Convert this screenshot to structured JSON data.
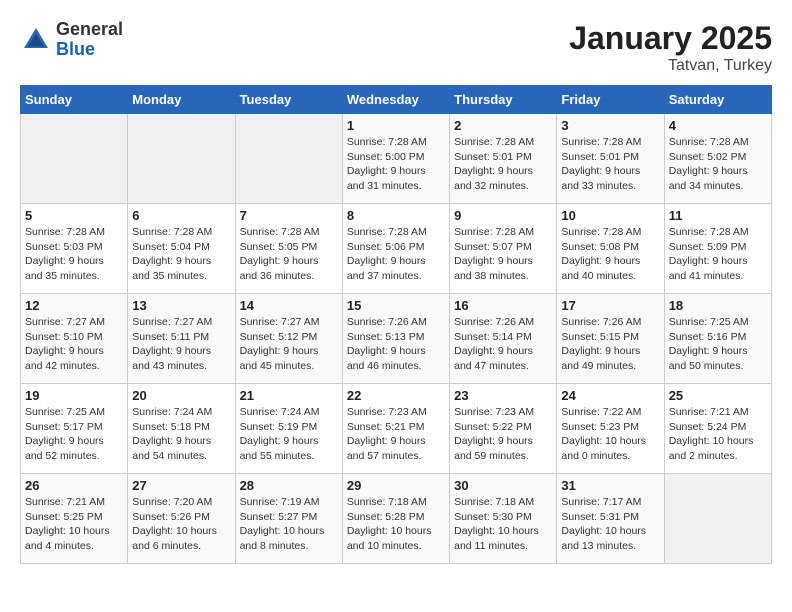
{
  "header": {
    "logo_general": "General",
    "logo_blue": "Blue",
    "month_year": "January 2025",
    "location": "Tatvan, Turkey"
  },
  "weekdays": [
    "Sunday",
    "Monday",
    "Tuesday",
    "Wednesday",
    "Thursday",
    "Friday",
    "Saturday"
  ],
  "weeks": [
    [
      {
        "day": "",
        "info": ""
      },
      {
        "day": "",
        "info": ""
      },
      {
        "day": "",
        "info": ""
      },
      {
        "day": "1",
        "info": "Sunrise: 7:28 AM\nSunset: 5:00 PM\nDaylight: 9 hours and 31 minutes."
      },
      {
        "day": "2",
        "info": "Sunrise: 7:28 AM\nSunset: 5:01 PM\nDaylight: 9 hours and 32 minutes."
      },
      {
        "day": "3",
        "info": "Sunrise: 7:28 AM\nSunset: 5:01 PM\nDaylight: 9 hours and 33 minutes."
      },
      {
        "day": "4",
        "info": "Sunrise: 7:28 AM\nSunset: 5:02 PM\nDaylight: 9 hours and 34 minutes."
      }
    ],
    [
      {
        "day": "5",
        "info": "Sunrise: 7:28 AM\nSunset: 5:03 PM\nDaylight: 9 hours and 35 minutes."
      },
      {
        "day": "6",
        "info": "Sunrise: 7:28 AM\nSunset: 5:04 PM\nDaylight: 9 hours and 35 minutes."
      },
      {
        "day": "7",
        "info": "Sunrise: 7:28 AM\nSunset: 5:05 PM\nDaylight: 9 hours and 36 minutes."
      },
      {
        "day": "8",
        "info": "Sunrise: 7:28 AM\nSunset: 5:06 PM\nDaylight: 9 hours and 37 minutes."
      },
      {
        "day": "9",
        "info": "Sunrise: 7:28 AM\nSunset: 5:07 PM\nDaylight: 9 hours and 38 minutes."
      },
      {
        "day": "10",
        "info": "Sunrise: 7:28 AM\nSunset: 5:08 PM\nDaylight: 9 hours and 40 minutes."
      },
      {
        "day": "11",
        "info": "Sunrise: 7:28 AM\nSunset: 5:09 PM\nDaylight: 9 hours and 41 minutes."
      }
    ],
    [
      {
        "day": "12",
        "info": "Sunrise: 7:27 AM\nSunset: 5:10 PM\nDaylight: 9 hours and 42 minutes."
      },
      {
        "day": "13",
        "info": "Sunrise: 7:27 AM\nSunset: 5:11 PM\nDaylight: 9 hours and 43 minutes."
      },
      {
        "day": "14",
        "info": "Sunrise: 7:27 AM\nSunset: 5:12 PM\nDaylight: 9 hours and 45 minutes."
      },
      {
        "day": "15",
        "info": "Sunrise: 7:26 AM\nSunset: 5:13 PM\nDaylight: 9 hours and 46 minutes."
      },
      {
        "day": "16",
        "info": "Sunrise: 7:26 AM\nSunset: 5:14 PM\nDaylight: 9 hours and 47 minutes."
      },
      {
        "day": "17",
        "info": "Sunrise: 7:26 AM\nSunset: 5:15 PM\nDaylight: 9 hours and 49 minutes."
      },
      {
        "day": "18",
        "info": "Sunrise: 7:25 AM\nSunset: 5:16 PM\nDaylight: 9 hours and 50 minutes."
      }
    ],
    [
      {
        "day": "19",
        "info": "Sunrise: 7:25 AM\nSunset: 5:17 PM\nDaylight: 9 hours and 52 minutes."
      },
      {
        "day": "20",
        "info": "Sunrise: 7:24 AM\nSunset: 5:18 PM\nDaylight: 9 hours and 54 minutes."
      },
      {
        "day": "21",
        "info": "Sunrise: 7:24 AM\nSunset: 5:19 PM\nDaylight: 9 hours and 55 minutes."
      },
      {
        "day": "22",
        "info": "Sunrise: 7:23 AM\nSunset: 5:21 PM\nDaylight: 9 hours and 57 minutes."
      },
      {
        "day": "23",
        "info": "Sunrise: 7:23 AM\nSunset: 5:22 PM\nDaylight: 9 hours and 59 minutes."
      },
      {
        "day": "24",
        "info": "Sunrise: 7:22 AM\nSunset: 5:23 PM\nDaylight: 10 hours and 0 minutes."
      },
      {
        "day": "25",
        "info": "Sunrise: 7:21 AM\nSunset: 5:24 PM\nDaylight: 10 hours and 2 minutes."
      }
    ],
    [
      {
        "day": "26",
        "info": "Sunrise: 7:21 AM\nSunset: 5:25 PM\nDaylight: 10 hours and 4 minutes."
      },
      {
        "day": "27",
        "info": "Sunrise: 7:20 AM\nSunset: 5:26 PM\nDaylight: 10 hours and 6 minutes."
      },
      {
        "day": "28",
        "info": "Sunrise: 7:19 AM\nSunset: 5:27 PM\nDaylight: 10 hours and 8 minutes."
      },
      {
        "day": "29",
        "info": "Sunrise: 7:18 AM\nSunset: 5:28 PM\nDaylight: 10 hours and 10 minutes."
      },
      {
        "day": "30",
        "info": "Sunrise: 7:18 AM\nSunset: 5:30 PM\nDaylight: 10 hours and 11 minutes."
      },
      {
        "day": "31",
        "info": "Sunrise: 7:17 AM\nSunset: 5:31 PM\nDaylight: 10 hours and 13 minutes."
      },
      {
        "day": "",
        "info": ""
      }
    ]
  ]
}
